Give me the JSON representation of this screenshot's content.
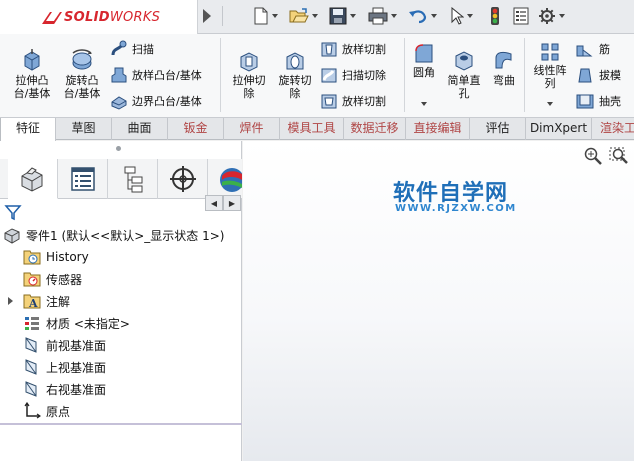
{
  "app": {
    "brand_prefix": "SOLID",
    "brand_suffix": "WORKS"
  },
  "quick_access": [
    {
      "icon": "new-document-icon"
    },
    {
      "icon": "open-folder-icon"
    },
    {
      "icon": "save-icon"
    },
    {
      "icon": "print-icon"
    },
    {
      "icon": "undo-icon"
    },
    {
      "icon": "select-cursor-icon"
    },
    {
      "icon": "rebuild-traffic-light-icon"
    },
    {
      "icon": "file-properties-icon"
    },
    {
      "icon": "options-gear-icon"
    }
  ],
  "ribbon": {
    "extrude_boss": "拉伸凸\n台/基体",
    "revolve_boss": "旋转凸\n台/基体",
    "sweep": "扫描",
    "loft_boss": "放样凸台/基体",
    "boundary_boss": "边界凸台/基体",
    "extrude_cut": "拉伸切\n除",
    "revolve_cut": "旋转切\n除",
    "loft_cut": "放样切割",
    "sweep_cut": "扫描切除",
    "boundary_cut": "放样切割",
    "fillet": "圆角",
    "simple_hole": "简单直\n孔",
    "bend": "弯曲",
    "linear_pattern": "线性阵\n列",
    "rib": "筋",
    "draft": "拔模",
    "shell": "抽壳"
  },
  "tabs": [
    {
      "label": "特征",
      "active": true
    },
    {
      "label": "草图"
    },
    {
      "label": "曲面"
    },
    {
      "label": "钣金",
      "dim": true
    },
    {
      "label": "焊件",
      "dim": true
    },
    {
      "label": "模具工具",
      "dim": true
    },
    {
      "label": "数据迁移",
      "dim": true
    },
    {
      "label": "直接编辑",
      "dim": true
    },
    {
      "label": "评估"
    },
    {
      "label": "DimXpert"
    },
    {
      "label": "渲染工",
      "dim": true
    }
  ],
  "feature_tree": {
    "root": "零件1  (默认<<默认>_显示状态 1>)",
    "items": [
      {
        "label": "History",
        "icon": "history-icon"
      },
      {
        "label": "传感器",
        "icon": "sensor-icon"
      },
      {
        "label": "注解",
        "icon": "annotation-icon",
        "expandable": true
      },
      {
        "label": "材质 <未指定>",
        "icon": "material-icon"
      },
      {
        "label": "前视基准面",
        "icon": "plane-icon"
      },
      {
        "label": "上视基准面",
        "icon": "plane-icon"
      },
      {
        "label": "右视基准面",
        "icon": "plane-icon"
      },
      {
        "label": "原点",
        "icon": "origin-icon"
      }
    ]
  },
  "watermark": {
    "title": "软件自学网",
    "url": "WWW.RJZXW.COM"
  }
}
